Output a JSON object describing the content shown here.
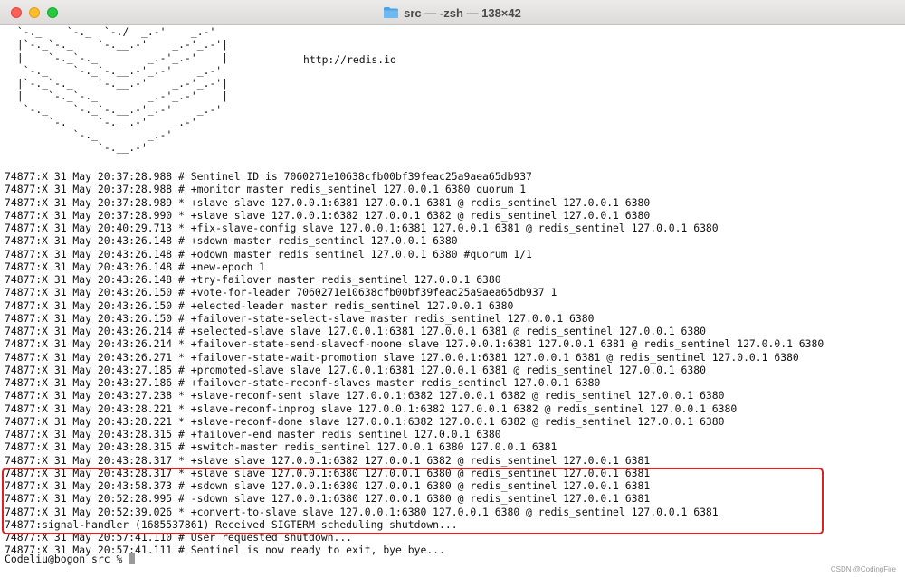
{
  "window": {
    "title": "src — -zsh — 138×42",
    "title_icon": "folder-icon",
    "traffic_lights": {
      "close_color": "#fe5f57",
      "minimize_color": "#febc2e",
      "maximize_color": "#28c840"
    }
  },
  "terminal": {
    "logo_lines": [
      " `-._    `-._  `-./  _.-'    _.-'",
      " |`-._`-._    `-.__.-'    _.-'_.-'|",
      " |    `-._`-._        _.-'_.-'    |",
      "  `-._    `-._`-.__.-'_.-'    _.-'",
      " |`-._`-._    `-.__.-'    _.-'_.-'|",
      " |    `-._`-._        _.-'_.-'    |",
      "  `-._    `-._`-.__.-'_.-'    _.-'",
      "      `-._    `-.__.-'    _.-'",
      "          `-._        _.-'",
      "              `-.__.-'"
    ],
    "url": "http://redis.io",
    "log_lines": [
      "74877:X 31 May 20:37:28.988 # Sentinel ID is 7060271e10638cfb00bf39feac25a9aea65db937",
      "74877:X 31 May 20:37:28.988 # +monitor master redis_sentinel 127.0.0.1 6380 quorum 1",
      "74877:X 31 May 20:37:28.989 * +slave slave 127.0.0.1:6381 127.0.0.1 6381 @ redis_sentinel 127.0.0.1 6380",
      "74877:X 31 May 20:37:28.990 * +slave slave 127.0.0.1:6382 127.0.0.1 6382 @ redis_sentinel 127.0.0.1 6380",
      "74877:X 31 May 20:40:29.713 * +fix-slave-config slave 127.0.0.1:6381 127.0.0.1 6381 @ redis_sentinel 127.0.0.1 6380",
      "74877:X 31 May 20:43:26.148 # +sdown master redis_sentinel 127.0.0.1 6380",
      "74877:X 31 May 20:43:26.148 # +odown master redis_sentinel 127.0.0.1 6380 #quorum 1/1",
      "74877:X 31 May 20:43:26.148 # +new-epoch 1",
      "74877:X 31 May 20:43:26.148 # +try-failover master redis_sentinel 127.0.0.1 6380",
      "74877:X 31 May 20:43:26.150 # +vote-for-leader 7060271e10638cfb00bf39feac25a9aea65db937 1",
      "74877:X 31 May 20:43:26.150 # +elected-leader master redis_sentinel 127.0.0.1 6380",
      "74877:X 31 May 20:43:26.150 # +failover-state-select-slave master redis_sentinel 127.0.0.1 6380",
      "74877:X 31 May 20:43:26.214 # +selected-slave slave 127.0.0.1:6381 127.0.0.1 6381 @ redis_sentinel 127.0.0.1 6380",
      "74877:X 31 May 20:43:26.214 * +failover-state-send-slaveof-noone slave 127.0.0.1:6381 127.0.0.1 6381 @ redis_sentinel 127.0.0.1 6380",
      "74877:X 31 May 20:43:26.271 * +failover-state-wait-promotion slave 127.0.0.1:6381 127.0.0.1 6381 @ redis_sentinel 127.0.0.1 6380",
      "74877:X 31 May 20:43:27.185 # +promoted-slave slave 127.0.0.1:6381 127.0.0.1 6381 @ redis_sentinel 127.0.0.1 6380",
      "74877:X 31 May 20:43:27.186 # +failover-state-reconf-slaves master redis_sentinel 127.0.0.1 6380",
      "74877:X 31 May 20:43:27.238 * +slave-reconf-sent slave 127.0.0.1:6382 127.0.0.1 6382 @ redis_sentinel 127.0.0.1 6380",
      "74877:X 31 May 20:43:28.221 * +slave-reconf-inprog slave 127.0.0.1:6382 127.0.0.1 6382 @ redis_sentinel 127.0.0.1 6380",
      "74877:X 31 May 20:43:28.221 * +slave-reconf-done slave 127.0.0.1:6382 127.0.0.1 6382 @ redis_sentinel 127.0.0.1 6380",
      "74877:X 31 May 20:43:28.315 # +failover-end master redis_sentinel 127.0.0.1 6380",
      "74877:X 31 May 20:43:28.315 # +switch-master redis_sentinel 127.0.0.1 6380 127.0.0.1 6381",
      "74877:X 31 May 20:43:28.317 * +slave slave 127.0.0.1:6382 127.0.0.1 6382 @ redis_sentinel 127.0.0.1 6381",
      "74877:X 31 May 20:43:28.317 * +slave slave 127.0.0.1:6380 127.0.0.1 6380 @ redis_sentinel 127.0.0.1 6381",
      "74877:X 31 May 20:43:58.373 # +sdown slave 127.0.0.1:6380 127.0.0.1 6380 @ redis_sentinel 127.0.0.1 6381",
      "74877:X 31 May 20:52:28.995 # -sdown slave 127.0.0.1:6380 127.0.0.1 6380 @ redis_sentinel 127.0.0.1 6381",
      "74877:X 31 May 20:52:39.026 * +convert-to-slave slave 127.0.0.1:6380 127.0.0.1 6380 @ redis_sentinel 127.0.0.1 6381",
      "74877:signal-handler (1685537861) Received SIGTERM scheduling shutdown...",
      "74877:X 31 May 20:57:41.110 # User requested shutdown...",
      "74877:X 31 May 20:57:41.111 # Sentinel is now ready to exit, bye bye..."
    ],
    "prompt": "Codeliu@bogon src % ",
    "highlight_color": "#e02020"
  },
  "watermark": "CSDN @CodingFire"
}
